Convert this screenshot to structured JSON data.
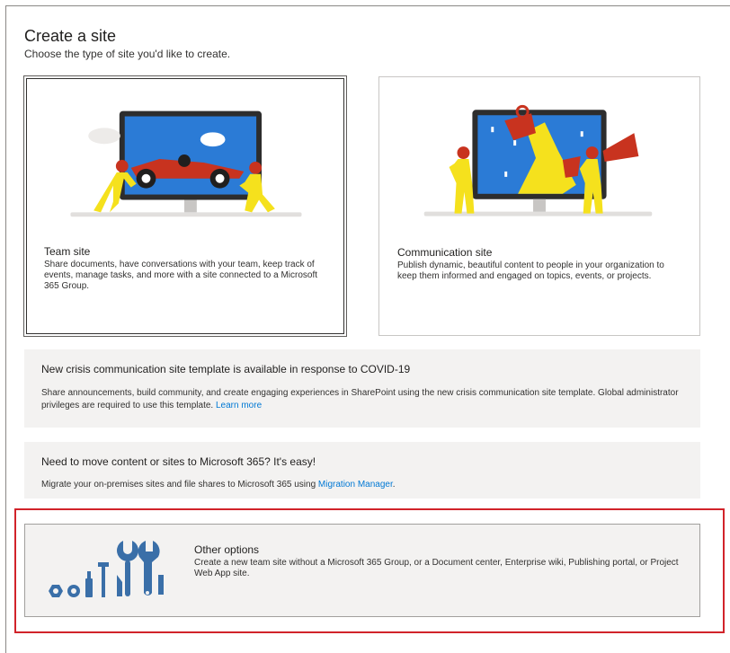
{
  "header": {
    "title": "Create a site",
    "subtitle": "Choose the type of site you'd like to create."
  },
  "team_site": {
    "title": "Team site",
    "description": "Share documents, have conversations with your team, keep track of events, manage tasks, and more with a site connected to a Microsoft 365 Group."
  },
  "communication_site": {
    "title": "Communication site",
    "description": "Publish dynamic, beautiful content to people in your organization to keep them informed and engaged on topics, events, or projects."
  },
  "crisis_banner": {
    "title": "New crisis communication site template is available in response to COVID-19",
    "text": "Share announcements, build community, and create engaging experiences in SharePoint using the new crisis communication site template. Global administrator privileges are required to use this template.",
    "link": "Learn more"
  },
  "migration_banner": {
    "title": "Need to move content or sites to Microsoft 365? It's easy!",
    "text": "Migrate your on-premises sites and file shares to Microsoft 365 using",
    "link": "Migration Manager",
    "suffix": "."
  },
  "other_options": {
    "title": "Other options",
    "description": "Create a new team site without a Microsoft 365 Group, or a Document center, Enterprise wiki, Publishing portal, or Project Web App site."
  },
  "colors": {
    "accent": "#0078d4",
    "highlight": "#d1232a",
    "illustration_blue": "#2b7bd6",
    "figure_yellow": "#f5e11d",
    "figure_red": "#c8331f",
    "tools_blue": "#3a6fa8"
  }
}
